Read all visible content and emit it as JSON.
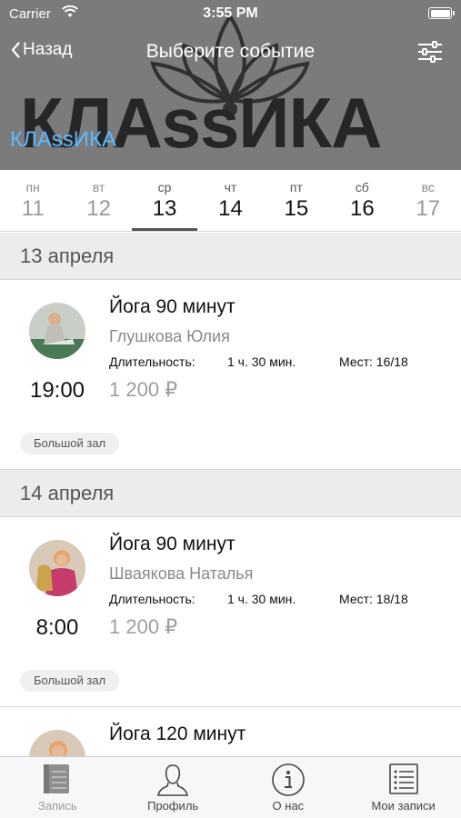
{
  "status_bar": {
    "carrier": "Carrier",
    "time": "3:55 PM"
  },
  "nav": {
    "back_label": "Назад",
    "title": "Выберите событие"
  },
  "header": {
    "brand_text": "КЛАssИКА",
    "club_name": "КЛАssИКА"
  },
  "days": [
    {
      "dow": "пн",
      "num": "11",
      "state": "past"
    },
    {
      "dow": "вт",
      "num": "12",
      "state": "past"
    },
    {
      "dow": "ср",
      "num": "13",
      "state": "selected"
    },
    {
      "dow": "чт",
      "num": "14",
      "state": "upcoming"
    },
    {
      "dow": "пт",
      "num": "15",
      "state": "upcoming"
    },
    {
      "dow": "сб",
      "num": "16",
      "state": "upcoming"
    },
    {
      "dow": "вс",
      "num": "17",
      "state": "past"
    }
  ],
  "sections": [
    {
      "date": "13 апреля",
      "events": [
        {
          "title": "Йога 90 минут",
          "trainer": "Глушкова Юлия",
          "duration_label": "Длительность:",
          "duration": "1 ч.  30 мин.",
          "places": "Мест: 16/18",
          "price": "1 200 ₽",
          "start": "19:00",
          "room": "Большой зал"
        }
      ]
    },
    {
      "date": "14 апреля",
      "events": [
        {
          "title": "Йога 90 минут",
          "trainer": "Шваякова Наталья",
          "duration_label": "Длительность:",
          "duration": "1 ч.  30 мин.",
          "places": "Мест: 18/18",
          "price": "1 200 ₽",
          "start": "8:00",
          "room": "Большой зал"
        },
        {
          "title": "Йога 120 минут"
        }
      ]
    }
  ],
  "tabbar": {
    "items": [
      {
        "label": "Запись",
        "icon": "notebook-icon",
        "active": true
      },
      {
        "label": "Профиль",
        "icon": "person-icon",
        "active": false
      },
      {
        "label": "О нас",
        "icon": "info-icon",
        "active": false
      },
      {
        "label": "Мои записи",
        "icon": "list-icon",
        "active": false
      }
    ]
  },
  "colors": {
    "header_bg": "#7b7b7b",
    "club_name": "#5db8ff",
    "section_bg": "#ececef",
    "price": "#9e9e9e"
  }
}
